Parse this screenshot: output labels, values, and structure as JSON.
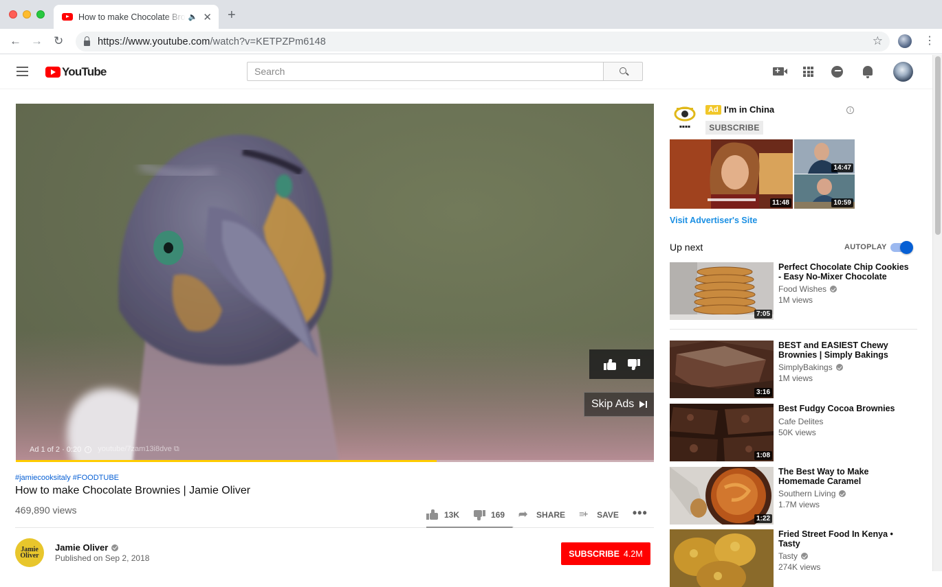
{
  "browser": {
    "tab_title": "How to make Chocolate Brownies | Jamie Oliver - YouTube",
    "url_host": "https://www.youtube.com",
    "url_path": "/watch?v=KETPZPm6148"
  },
  "youtube": {
    "logo_text": "YouTube",
    "search_placeholder": "Search"
  },
  "player": {
    "ad_status": "Ad 1 of 2 · 0:20",
    "ad_link": "youtube/7zam13i8dve",
    "skip_label": "Skip Ads",
    "ad_progress": 0.66
  },
  "video": {
    "hashtags": "#jamiecooksitaly #FOODTUBE",
    "title": "How to make Chocolate Brownies | Jamie Oliver",
    "views": "469,890 views",
    "likes": "13K",
    "dislikes": "169",
    "share_label": "SHARE",
    "save_label": "SAVE",
    "like_ratio": 0.99
  },
  "channel": {
    "avatar_text": "Jamie Oliver",
    "name": "Jamie Oliver",
    "published": "Published on Sep 2, 2018",
    "subscribe_label": "SUBSCRIBE",
    "subscriber_count": "4.2M"
  },
  "sidebar_ad": {
    "badge": "Ad",
    "title": "I'm in China",
    "subscribe_label": "SUBSCRIBE",
    "durations": [
      "11:48",
      "14:47",
      "10:59"
    ],
    "visit_label": "Visit Advertiser's Site"
  },
  "upnext": {
    "label": "Up next",
    "autoplay_label": "AUTOPLAY",
    "autoplay_on": true,
    "items": [
      {
        "title": "Perfect Chocolate Chip Cookies - Easy No-Mixer Chocolate Chi…",
        "channel": "Food Wishes",
        "views": "1M views",
        "duration": "7:05"
      },
      {
        "title": "BEST and EASIEST Chewy Brownies | Simply Bakings",
        "channel": "SimplyBakings",
        "views": "1M views",
        "duration": "3:16"
      },
      {
        "title": "Best Fudgy Cocoa Brownies",
        "channel": "Cafe Delites",
        "views": "50K views",
        "duration": "1:08"
      },
      {
        "title": "The Best Way to Make Homemade Caramel",
        "channel": "Southern Living",
        "views": "1.7M views",
        "duration": "1:22"
      },
      {
        "title": "Fried Street Food In Kenya • Tasty",
        "channel": "Tasty",
        "views": "274K views",
        "duration": ""
      }
    ]
  }
}
